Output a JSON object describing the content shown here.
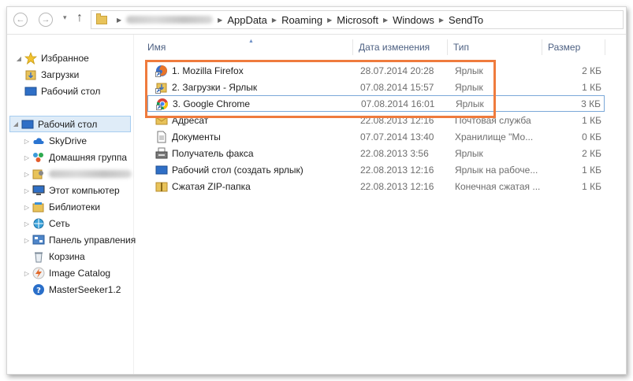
{
  "breadcrumb": [
    "AppData",
    "Roaming",
    "Microsoft",
    "Windows",
    "SendTo"
  ],
  "nav_buttons": {
    "back": "←",
    "forward": "→",
    "dropdown": "▾",
    "up": "↑"
  },
  "sidebar": {
    "favorites_label": "Избранное",
    "favorites": [
      "Загрузки",
      "Рабочий стол"
    ],
    "desktop_label": "Рабочий стол",
    "items": [
      "SkyDrive",
      "Домашняя группа",
      "Этот компьютер",
      "Библиотеки",
      "Сеть",
      "Панель управления",
      "Корзина",
      "Image Catalog",
      "MasterSeeker1.2"
    ]
  },
  "columns": {
    "name": "Имя",
    "date": "Дата изменения",
    "type": "Тип",
    "size": "Размер"
  },
  "files": [
    {
      "name": "1. Mozilla Firefox",
      "date": "28.07.2014 20:28",
      "type": "Ярлык",
      "size": "2 КБ",
      "icon": "firefox-shortcut-icon"
    },
    {
      "name": "2. Загрузки - Ярлык",
      "date": "07.08.2014 15:57",
      "type": "Ярлык",
      "size": "1 КБ",
      "icon": "downloads-shortcut-icon"
    },
    {
      "name": "3. Google Chrome",
      "date": "07.08.2014 16:01",
      "type": "Ярлык",
      "size": "3 КБ",
      "icon": "chrome-shortcut-icon"
    },
    {
      "name": "Адресат",
      "date": "22.08.2013 12:16",
      "type": "Почтовая служба",
      "size": "1 КБ",
      "icon": "mail-recipient-icon"
    },
    {
      "name": "Документы",
      "date": "07.07.2014 13:40",
      "type": "Хранилище \"Мо...",
      "size": "0 КБ",
      "icon": "documents-icon"
    },
    {
      "name": "Получатель факса",
      "date": "22.08.2013 3:56",
      "type": "Ярлык",
      "size": "2 КБ",
      "icon": "fax-icon"
    },
    {
      "name": "Рабочий стол (создать ярлык)",
      "date": "22.08.2013 12:16",
      "type": "Ярлык на рабоче...",
      "size": "1 КБ",
      "icon": "desktop-icon"
    },
    {
      "name": "Сжатая ZIP-папка",
      "date": "22.08.2013 12:16",
      "type": "Конечная сжатая ...",
      "size": "1 КБ",
      "icon": "zip-folder-icon"
    }
  ],
  "colors": {
    "highlight": "#ef7b3d",
    "selection": "#dfecf8",
    "header_text": "#4d6082"
  }
}
